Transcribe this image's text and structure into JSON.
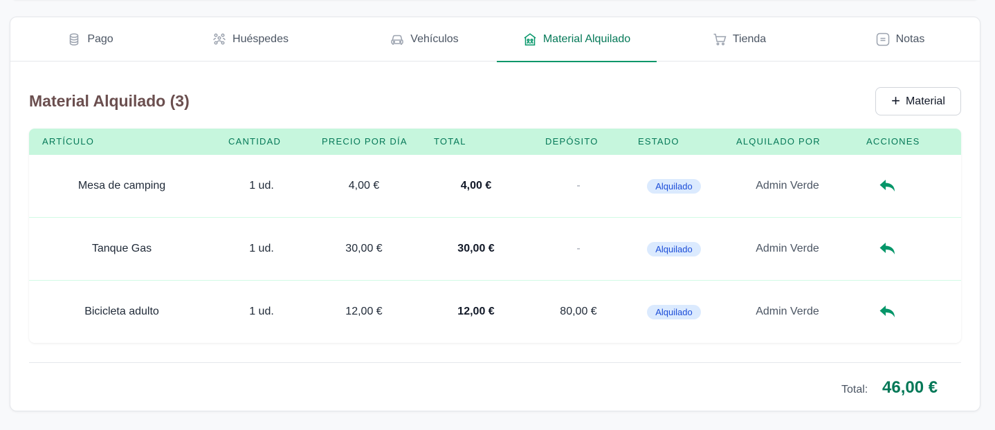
{
  "tabs": [
    {
      "label": "Pago",
      "icon": "coins-icon"
    },
    {
      "label": "Huéspedes",
      "icon": "users-icon"
    },
    {
      "label": "Vehículos",
      "icon": "car-icon"
    },
    {
      "label": "Material Alquilado",
      "icon": "store-icon",
      "active": true
    },
    {
      "label": "Tienda",
      "icon": "cart-icon"
    },
    {
      "label": "Notas",
      "icon": "note-icon"
    }
  ],
  "section": {
    "title": "Material Alquilado (3)",
    "add_button_label": "Material",
    "add_button_icon": "plus-icon"
  },
  "table": {
    "headers": [
      "Artículo",
      "Cantidad",
      "Precio por día",
      "Total",
      "Depósito",
      "Estado",
      "Alquilado por",
      "Acciones"
    ],
    "rows": [
      {
        "item": "Mesa de camping",
        "quantity": "1 ud.",
        "price_per_day": "4,00 €",
        "total": "4,00 €",
        "deposit": "-",
        "status": "Alquilado",
        "rented_by": "Admin Verde",
        "action_icon": "return-icon"
      },
      {
        "item": "Tanque Gas",
        "quantity": "1 ud.",
        "price_per_day": "30,00 €",
        "total": "30,00 €",
        "deposit": "-",
        "status": "Alquilado",
        "rented_by": "Admin Verde",
        "action_icon": "return-icon"
      },
      {
        "item": "Bicicleta adulto",
        "quantity": "1 ud.",
        "price_per_day": "12,00 €",
        "total": "12,00 €",
        "deposit": "80,00 €",
        "status": "Alquilado",
        "rented_by": "Admin Verde",
        "action_icon": "return-icon"
      }
    ]
  },
  "footer": {
    "total_label": "Total:",
    "total_value": "46,00 €"
  },
  "colors": {
    "accent": "#059669",
    "header_bg": "#c6f6dd",
    "badge_bg": "#dbeafe",
    "title": "#6b4f4f"
  }
}
